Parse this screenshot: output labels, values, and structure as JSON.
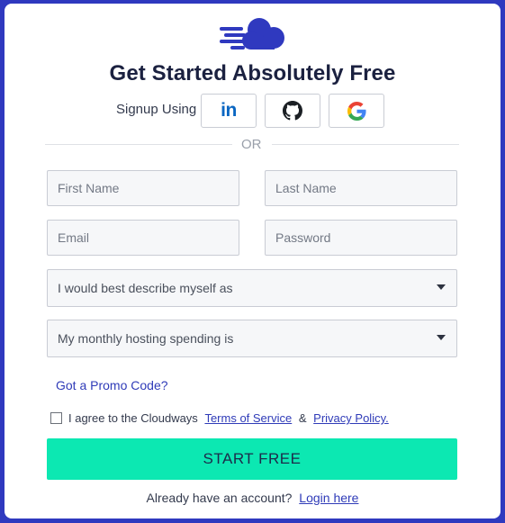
{
  "header": {
    "title": "Get Started Absolutely Free",
    "logo_icon": "cloudways-cloud-logo"
  },
  "social": {
    "label": "Signup Using",
    "providers": [
      {
        "name": "linkedin",
        "icon": "linkedin-icon",
        "text": "in",
        "color": "#0a66c2"
      },
      {
        "name": "github",
        "icon": "github-icon"
      },
      {
        "name": "google",
        "icon": "google-icon"
      }
    ]
  },
  "divider": {
    "text": "OR"
  },
  "form": {
    "first_name": {
      "placeholder": "First Name",
      "value": ""
    },
    "last_name": {
      "placeholder": "Last Name",
      "value": ""
    },
    "email": {
      "placeholder": "Email",
      "value": ""
    },
    "password": {
      "placeholder": "Password",
      "value": ""
    },
    "describe_select": {
      "selected": "I would best describe myself as"
    },
    "spending_select": {
      "selected": "My monthly hosting spending is"
    }
  },
  "promo": {
    "label": "Got a Promo Code?"
  },
  "terms": {
    "checked": false,
    "prefix": "I agree to the Cloudways",
    "tos_link": "Terms of Service",
    "amp": "&",
    "privacy_link": "Privacy Policy."
  },
  "submit": {
    "label": "START FREE"
  },
  "footer": {
    "prompt": "Already have an account?",
    "login_link": "Login here"
  },
  "colors": {
    "background": "#2f39bf",
    "accent_button": "#0ce8b2",
    "link": "#2f3bb8",
    "logo": "#2f39bf"
  }
}
